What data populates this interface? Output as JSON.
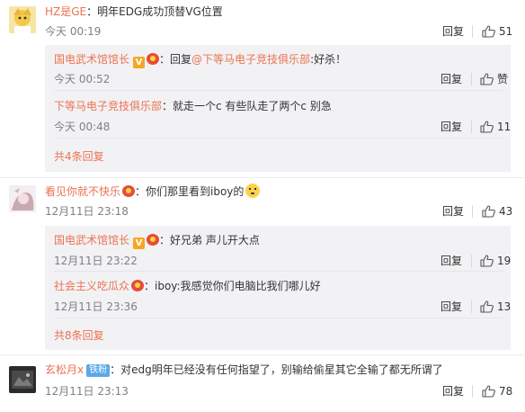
{
  "comments": [
    {
      "username": "HZ是GE",
      "text": "：明年EDG成功顶替VG位置",
      "time": "今天 00:19",
      "reply_label": "回复",
      "likes": "51",
      "replies": [
        {
          "username": "国电武术馆馆长",
          "colon": "：",
          "reply_prefix": "回复",
          "at": "@下等马电子竞技俱乐部",
          "text": ":好杀！",
          "time": "今天 00:52",
          "reply_label": "回复",
          "likes": "赞"
        },
        {
          "username": "下等马电子竞技俱乐部",
          "text": "：就走一个c 有些队走了两个c 别急",
          "time": "今天 00:48",
          "reply_label": "回复",
          "likes": "11"
        }
      ],
      "more": "共4条回复"
    },
    {
      "username": "看见你就不快乐",
      "text": "：你们那里看到iboy的",
      "time": "12月11日 23:18",
      "reply_label": "回复",
      "likes": "43",
      "replies": [
        {
          "username": "国电武术馆馆长",
          "text": "：好兄弟 声儿开大点",
          "time": "12月11日 23:22",
          "reply_label": "回复",
          "likes": "19"
        },
        {
          "username": "社会主义吃瓜众",
          "text": "：iboy:我感觉你们电脑比我们哪儿好",
          "time": "12月11日 23:36",
          "reply_label": "回复",
          "likes": "13"
        }
      ],
      "more": "共8条回复"
    },
    {
      "username": "玄松月x",
      "badge": "铁粉",
      "text": "：对edg明年已经没有任何指望了，别输给偷星其它全输了都无所谓了",
      "time": "12月11日 23:13",
      "reply_label": "回复",
      "likes": "78"
    }
  ],
  "colors": {
    "username": "#eb7350",
    "reply_bg": "#f2f2f5",
    "iron_badge": "#5aa9e6"
  }
}
